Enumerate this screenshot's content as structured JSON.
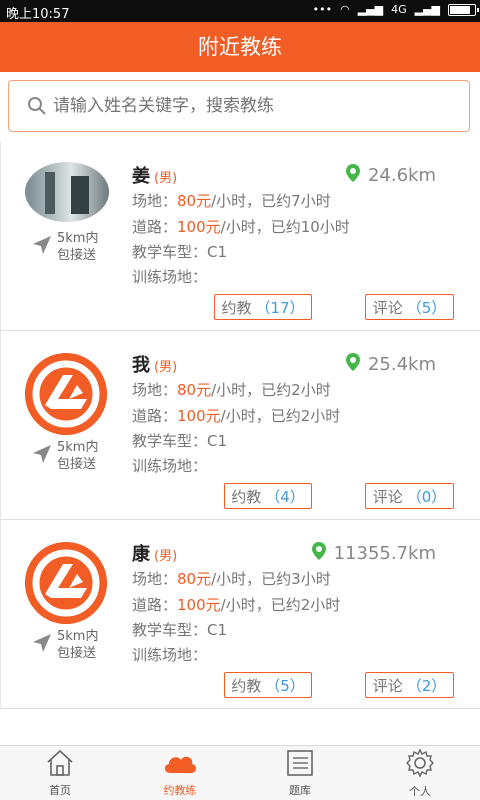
{
  "status": {
    "time": "晚上10:57",
    "net": "4G"
  },
  "header": {
    "title": "附近教练"
  },
  "search": {
    "placeholder": "请输入姓名关键字，搜索教练"
  },
  "colors": {
    "accent": "#f25c25",
    "count": "#3d9bd8"
  },
  "coaches": [
    {
      "surname": "姜",
      "sex": "(男)",
      "distance": "24.6km",
      "site_label": "场地：",
      "site_price": "80元",
      "site_rest": "/小时，已约7小时",
      "road_label": "道路：",
      "road_price": "100元",
      "road_rest": "/小时，已约10小时",
      "car_label": "教学车型：",
      "car": "C1",
      "field_label": "训练场地：",
      "pickup_1": "5km内",
      "pickup_2": "包接送",
      "book_label": "约教",
      "book_count": "（17）",
      "review_label": "评论",
      "review_count": "（5）",
      "avatar": "photo"
    },
    {
      "surname": "我",
      "sex": "(男)",
      "distance": "25.4km",
      "site_label": "场地：",
      "site_price": "80元",
      "site_rest": "/小时，已约2小时",
      "road_label": "道路：",
      "road_price": "100元",
      "road_rest": "/小时，已约2小时",
      "car_label": "教学车型：",
      "car": "C1",
      "field_label": "训练场地：",
      "pickup_1": "5km内",
      "pickup_2": "包接送",
      "book_label": "约教",
      "book_count": "（4）",
      "review_label": "评论",
      "review_count": "（0）",
      "avatar": "logo"
    },
    {
      "surname": "康",
      "sex": "(男)",
      "distance": "11355.7km",
      "site_label": "场地：",
      "site_price": "80元",
      "site_rest": "/小时，已约3小时",
      "road_label": "道路：",
      "road_price": "100元",
      "road_rest": "/小时，已约2小时",
      "car_label": "教学车型：",
      "car": "C1",
      "field_label": "训练场地：",
      "pickup_1": "5km内",
      "pickup_2": "包接送",
      "book_label": "约教",
      "book_count": "（5）",
      "review_label": "评论",
      "review_count": "（2）",
      "avatar": "logo"
    }
  ],
  "tabs": [
    {
      "label": "首页",
      "icon": "home-icon"
    },
    {
      "label": "约教练",
      "icon": "cloud-icon",
      "active": true
    },
    {
      "label": "题库",
      "icon": "list-icon"
    },
    {
      "label": "个人",
      "icon": "gear-icon"
    }
  ]
}
